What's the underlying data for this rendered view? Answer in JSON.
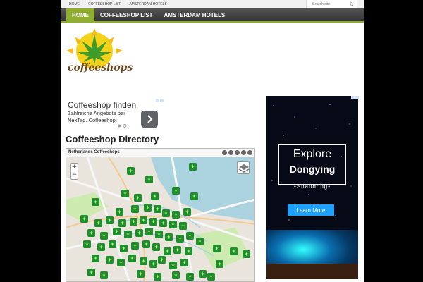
{
  "topbar": {
    "links": [
      "HOME",
      "COFFEESHOP LIST",
      "AMSTERDAM HOTELS"
    ],
    "search_placeholder": "Search site"
  },
  "nav": {
    "items": [
      "HOME",
      "COFFEESHOP LIST",
      "AMSTERDAM HOTELS"
    ],
    "active_index": 0
  },
  "logo": {
    "text": "coffeeshops"
  },
  "ad_block": {
    "title": "Coffeeshop finden",
    "text": "Zahlreiche Angebote bei NexTag. Coffeeshop:"
  },
  "section": {
    "heading": "Coffeeshop Directory"
  },
  "map": {
    "title": "Netherlands Coffeeshops",
    "zoom_in": "+",
    "zoom_out": "−"
  },
  "right_ad": {
    "line1": "Explore",
    "line2": "Dongying",
    "line3": "•Shandong•",
    "button": "Learn More"
  },
  "colors": {
    "accent_green": "#8fad2f",
    "nav_dark": "#444444",
    "pin_green": "#1e8f2a",
    "ad_button": "#1ea0ff"
  },
  "icons": [
    "search-icon",
    "adchoices-icon",
    "layers-icon",
    "cannabis-leaf-icon",
    "chevron-right-icon"
  ]
}
